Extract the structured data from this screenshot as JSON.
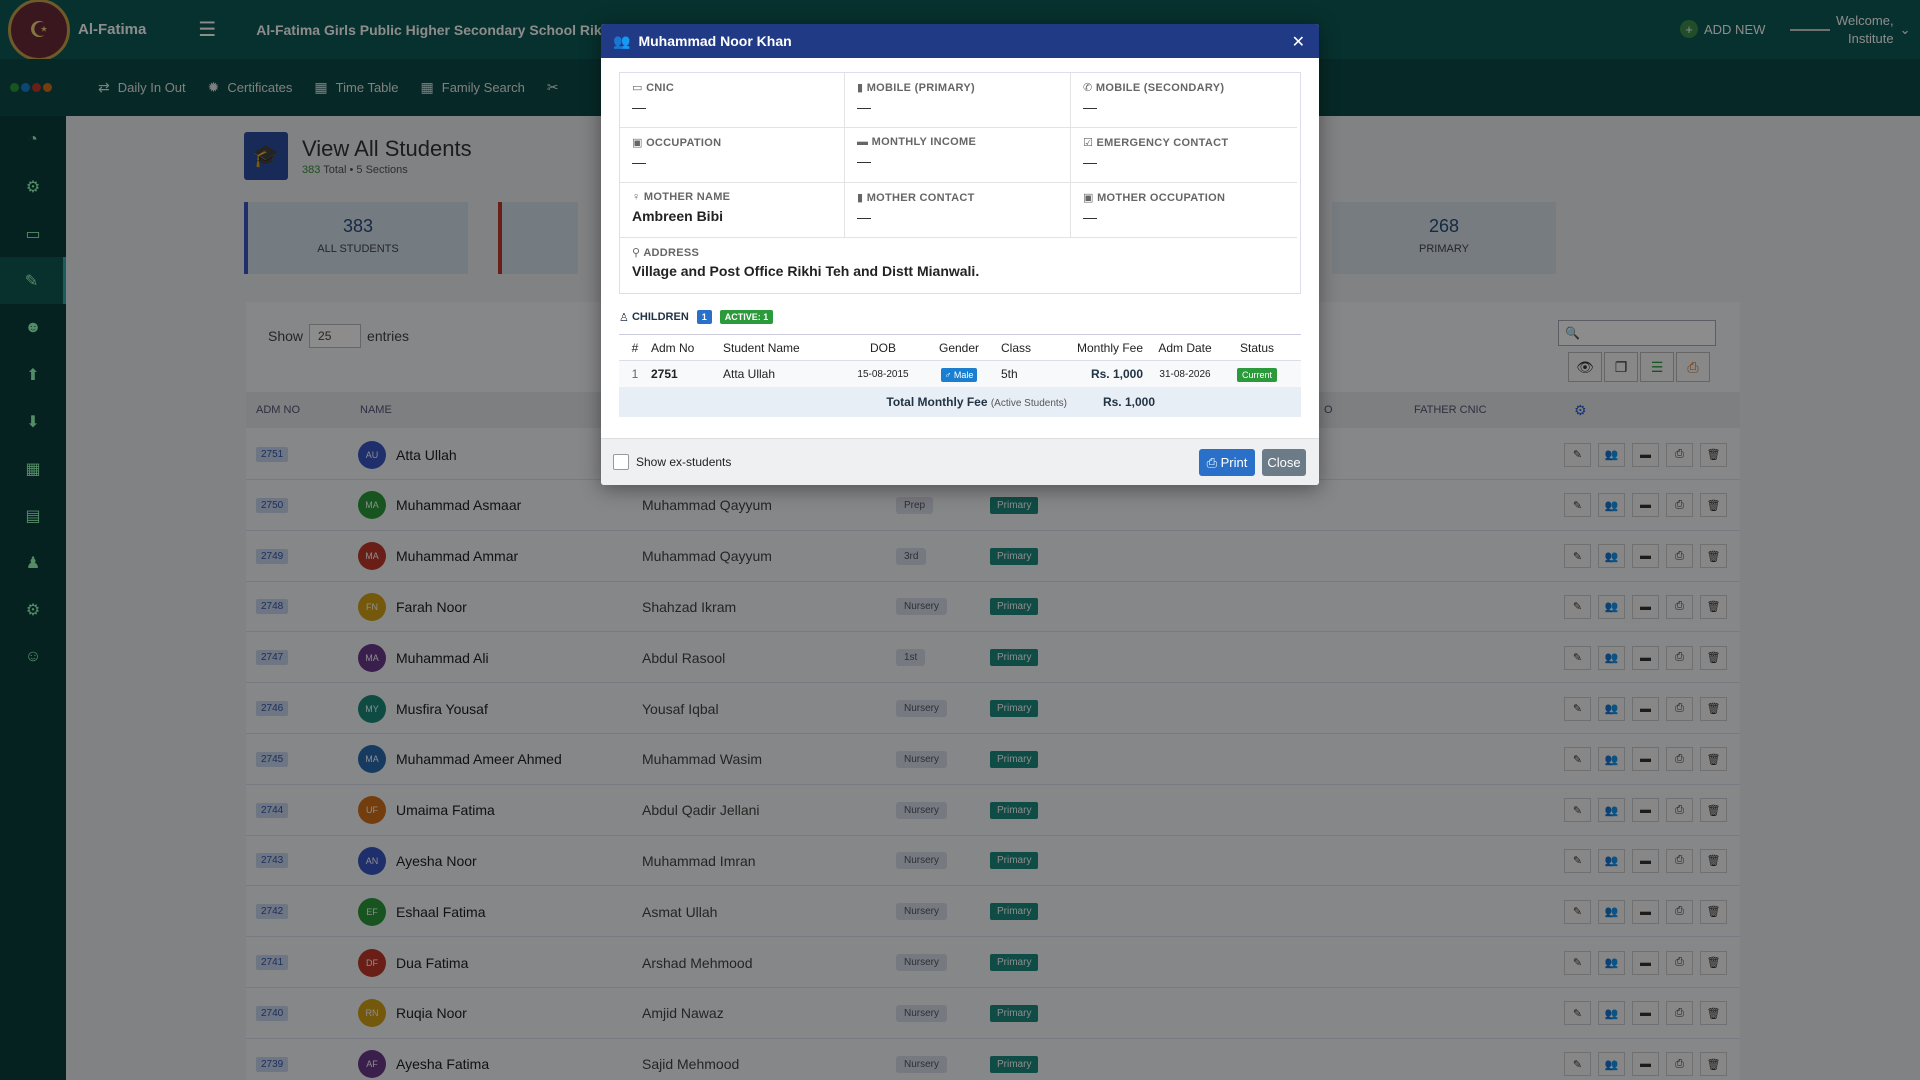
{
  "app": {
    "brand": "Al-Fatima",
    "school": "Al-Fatima Girls Public Higher Secondary School Rikhi Mo",
    "add_new": "ADD NEW",
    "welcome": "Welcome,",
    "user": "Institute"
  },
  "subnav": {
    "items": [
      "Daily In Out",
      "Certificates",
      "Time Table",
      "Family Search"
    ]
  },
  "page": {
    "title": "View All Students",
    "total": "383",
    "sub": " Total • 5 Sections"
  },
  "stats": [
    {
      "value": "383",
      "label": "ALL STUDENTS"
    },
    {
      "value": "268",
      "label": "PRIMARY"
    }
  ],
  "table": {
    "show_label": "Show",
    "entries_value": "25",
    "entries_label": "entries",
    "headers": {
      "adm": "ADM NO",
      "name": "NAME",
      "o": "O",
      "father_cnic": "FATHER CNIC"
    },
    "rows": [
      {
        "adm": "2751",
        "initials": "AU",
        "color": "#3a57c4",
        "name": "Atta Ullah",
        "father": "",
        "cls": "",
        "sec": ""
      },
      {
        "adm": "2750",
        "initials": "MA",
        "color": "#2a9a3a",
        "name": "Muhammad Asmaar",
        "father": "Muhammad Qayyum",
        "cls": "Prep",
        "sec": "Primary"
      },
      {
        "adm": "2749",
        "initials": "MA",
        "color": "#c0392b",
        "name": "Muhammad Ammar",
        "father": "Muhammad Qayyum",
        "cls": "3rd",
        "sec": "Primary"
      },
      {
        "adm": "2748",
        "initials": "FN",
        "color": "#d4a017",
        "name": "Farah Noor",
        "father": "Shahzad Ikram",
        "cls": "Nursery",
        "sec": "Primary"
      },
      {
        "adm": "2747",
        "initials": "MA",
        "color": "#6a3a8c",
        "name": "Muhammad Ali",
        "father": "Abdul Rasool",
        "cls": "1st",
        "sec": "Primary"
      },
      {
        "adm": "2746",
        "initials": "MY",
        "color": "#1a8a7a",
        "name": "Musfira Yousaf",
        "father": "Yousaf Iqbal",
        "cls": "Nursery",
        "sec": "Primary"
      },
      {
        "adm": "2745",
        "initials": "MA",
        "color": "#2a6ab0",
        "name": "Muhammad Ameer Ahmed",
        "father": "Muhammad Wasim",
        "cls": "Nursery",
        "sec": "Primary"
      },
      {
        "adm": "2744",
        "initials": "UF",
        "color": "#d4701a",
        "name": "Umaima Fatima",
        "father": "Abdul Qadir Jellani",
        "cls": "Nursery",
        "sec": "Primary"
      },
      {
        "adm": "2743",
        "initials": "AN",
        "color": "#3a57c4",
        "name": "Ayesha Noor",
        "father": "Muhammad Imran",
        "cls": "Nursery",
        "sec": "Primary"
      },
      {
        "adm": "2742",
        "initials": "EF",
        "color": "#2a9a3a",
        "name": "Eshaal Fatima",
        "father": "Asmat Ullah",
        "cls": "Nursery",
        "sec": "Primary"
      },
      {
        "adm": "2741",
        "initials": "DF",
        "color": "#c0392b",
        "name": "Dua Fatima",
        "father": "Arshad Mehmood",
        "cls": "Nursery",
        "sec": "Primary"
      },
      {
        "adm": "2740",
        "initials": "RN",
        "color": "#d4a017",
        "name": "Ruqia Noor",
        "father": "Amjid Nawaz",
        "cls": "Nursery",
        "sec": "Primary"
      },
      {
        "adm": "2739",
        "initials": "AF",
        "color": "#6a3a8c",
        "name": "Ayesha Fatima",
        "father": "Sajid Mehmood",
        "cls": "Nursery",
        "sec": "Primary"
      }
    ]
  },
  "modal": {
    "title": "Muhammad Noor Khan",
    "fields": [
      {
        "key": "CNIC",
        "value": "—"
      },
      {
        "key": "MOBILE (PRIMARY)",
        "value": "—"
      },
      {
        "key": "MOBILE (SECONDARY)",
        "value": "—"
      },
      {
        "key": "OCCUPATION",
        "value": "—"
      },
      {
        "key": "MONTHLY INCOME",
        "value": "—"
      },
      {
        "key": "EMERGENCY CONTACT",
        "value": "—"
      },
      {
        "key": "MOTHER NAME",
        "value": "Ambreen Bibi"
      },
      {
        "key": "MOTHER CONTACT",
        "value": "—"
      },
      {
        "key": "MOTHER OCCUPATION",
        "value": "—"
      }
    ],
    "address_label": "ADDRESS",
    "address": "Village and Post Office Rikhi Teh and Distt Mianwali.",
    "children_label": "CHILDREN",
    "children_count": "1",
    "active_label": "ACTIVE: 1",
    "child_headers": [
      "#",
      "Adm No",
      "Student Name",
      "DOB",
      "Gender",
      "Class",
      "Monthly Fee",
      "Adm Date",
      "Status"
    ],
    "child": {
      "n": "1",
      "adm": "2751",
      "name": "Atta Ullah",
      "dob": "15-08-2015",
      "gender": "Male",
      "cls": "5th",
      "fee": "Rs. 1,000",
      "adm_date": "31-08-2026",
      "status": "Current"
    },
    "total_label": "Total Monthly Fee",
    "total_note": "(Active Students)",
    "total_value": "Rs. 1,000",
    "show_ex": "Show ex-students",
    "print": "Print",
    "close": "Close"
  }
}
